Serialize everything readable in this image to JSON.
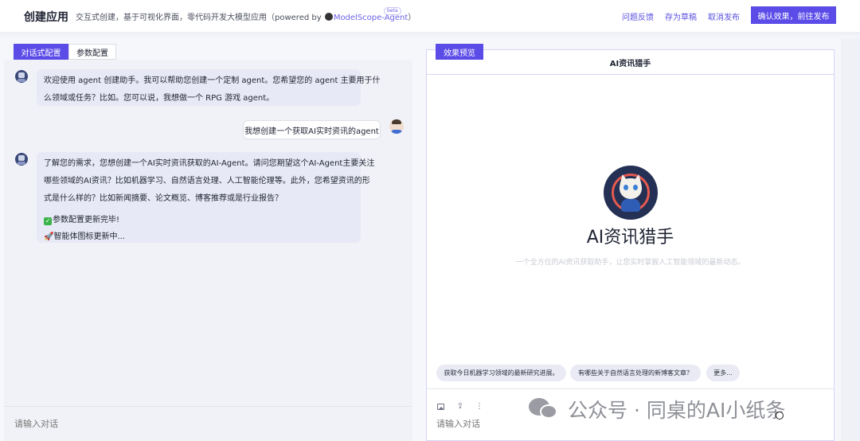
{
  "header": {
    "title": "创建应用",
    "subtitle_prefix": "交互式创建，基于可视化界面，零代码开发大模型应用（powered by ",
    "subtitle_link": "ModelScope-Agent",
    "subtitle_suffix": "）",
    "beta": "beta",
    "feedback": "问题反馈",
    "save_draft": "存为草稿",
    "cancel_publish": "取消发布",
    "confirm_publish": "确认效果，前往发布"
  },
  "left": {
    "tabs": [
      "对话式配置",
      "参数配置"
    ],
    "messages": {
      "bot1_line1": "欢迎使用 agent 创建助手。我可以帮助您创建一个定制 agent。您希望您的 agent 主要用于什",
      "bot1_line2": "么领域或任务？比如。您可以说，我想做一个 RPG 游戏 agent。",
      "user1": "我想创建一个获取AI实时资讯的agent",
      "bot2_line1": "了解您的需求，您想创建一个AI实时资讯获取的AI-Agent。请问您期望这个AI-Agent主要关注",
      "bot2_line2": "哪些领域的AI资讯？比如机器学习、自然语言处理、人工智能伦理等。此外，您希望资讯的形",
      "bot2_line3": "式是什么样的？比如新闻摘要、论文概览、博客推荐或是行业报告？",
      "bot2_status1": "参数配置更新完毕!",
      "bot2_status2": "🚀智能体图标更新中..."
    },
    "input_placeholder": "请输入对话"
  },
  "right": {
    "tab": "效果预览",
    "title": "AI资讯猎手",
    "agent_name": "AI资讯猎手",
    "agent_desc": "一个全方位的AI资讯获取助手，让您实时掌握人工智能领域的最新动态。",
    "suggestions": [
      "获取今日机器学习领域的最新研究进展。",
      "有哪些关于自然语言处理的新博客文章？",
      "更多..."
    ],
    "input_placeholder": "请输入对话"
  },
  "watermark": "公众号 · 同桌的AI小纸条",
  "colors": {
    "accent": "#5b4ce8",
    "bot_bubble": "#e8e9f6",
    "panel_border": "#d6d3f5"
  }
}
